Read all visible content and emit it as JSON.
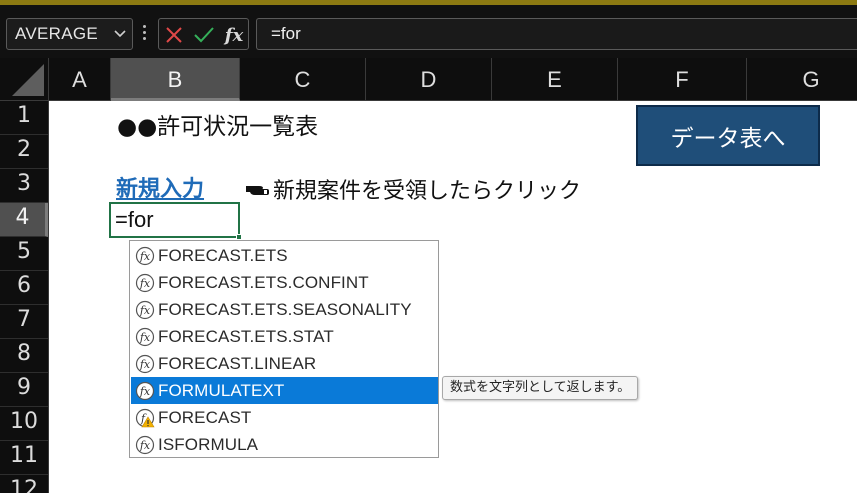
{
  "name_box": {
    "value": "AVERAGE"
  },
  "formula_bar": {
    "value": "=for",
    "fx_label": "fx"
  },
  "columns": [
    "A",
    "B",
    "C",
    "D",
    "E",
    "F",
    "G"
  ],
  "selected_column": "B",
  "rows": [
    "1",
    "2",
    "3",
    "4",
    "5",
    "6",
    "7",
    "8",
    "9",
    "10",
    "11",
    "12"
  ],
  "selected_row": "4",
  "sheet": {
    "title": "●●許可状況一覧表",
    "new_entry_link": "新規入力",
    "hint_text": "新規案件を受領したらクリック",
    "data_button": "データ表へ",
    "active_cell_value": "=for"
  },
  "autocomplete": {
    "items": [
      {
        "label": "FORECAST.ETS",
        "icon": "function-icon"
      },
      {
        "label": "FORECAST.ETS.CONFINT",
        "icon": "function-icon"
      },
      {
        "label": "FORECAST.ETS.SEASONALITY",
        "icon": "function-icon"
      },
      {
        "label": "FORECAST.ETS.STAT",
        "icon": "function-icon"
      },
      {
        "label": "FORECAST.LINEAR",
        "icon": "function-icon"
      },
      {
        "label": "FORMULATEXT",
        "icon": "function-icon",
        "selected": true
      },
      {
        "label": "FORECAST",
        "icon": "function-warning-icon"
      },
      {
        "label": "ISFORMULA",
        "icon": "function-icon"
      }
    ],
    "tooltip": "数式を文字列として返します。"
  },
  "colors": {
    "accent_selection": "#0a7ad8",
    "active_cell_border": "#217346",
    "data_button_bg": "#1f4e79",
    "link": "#1f6bb8"
  }
}
